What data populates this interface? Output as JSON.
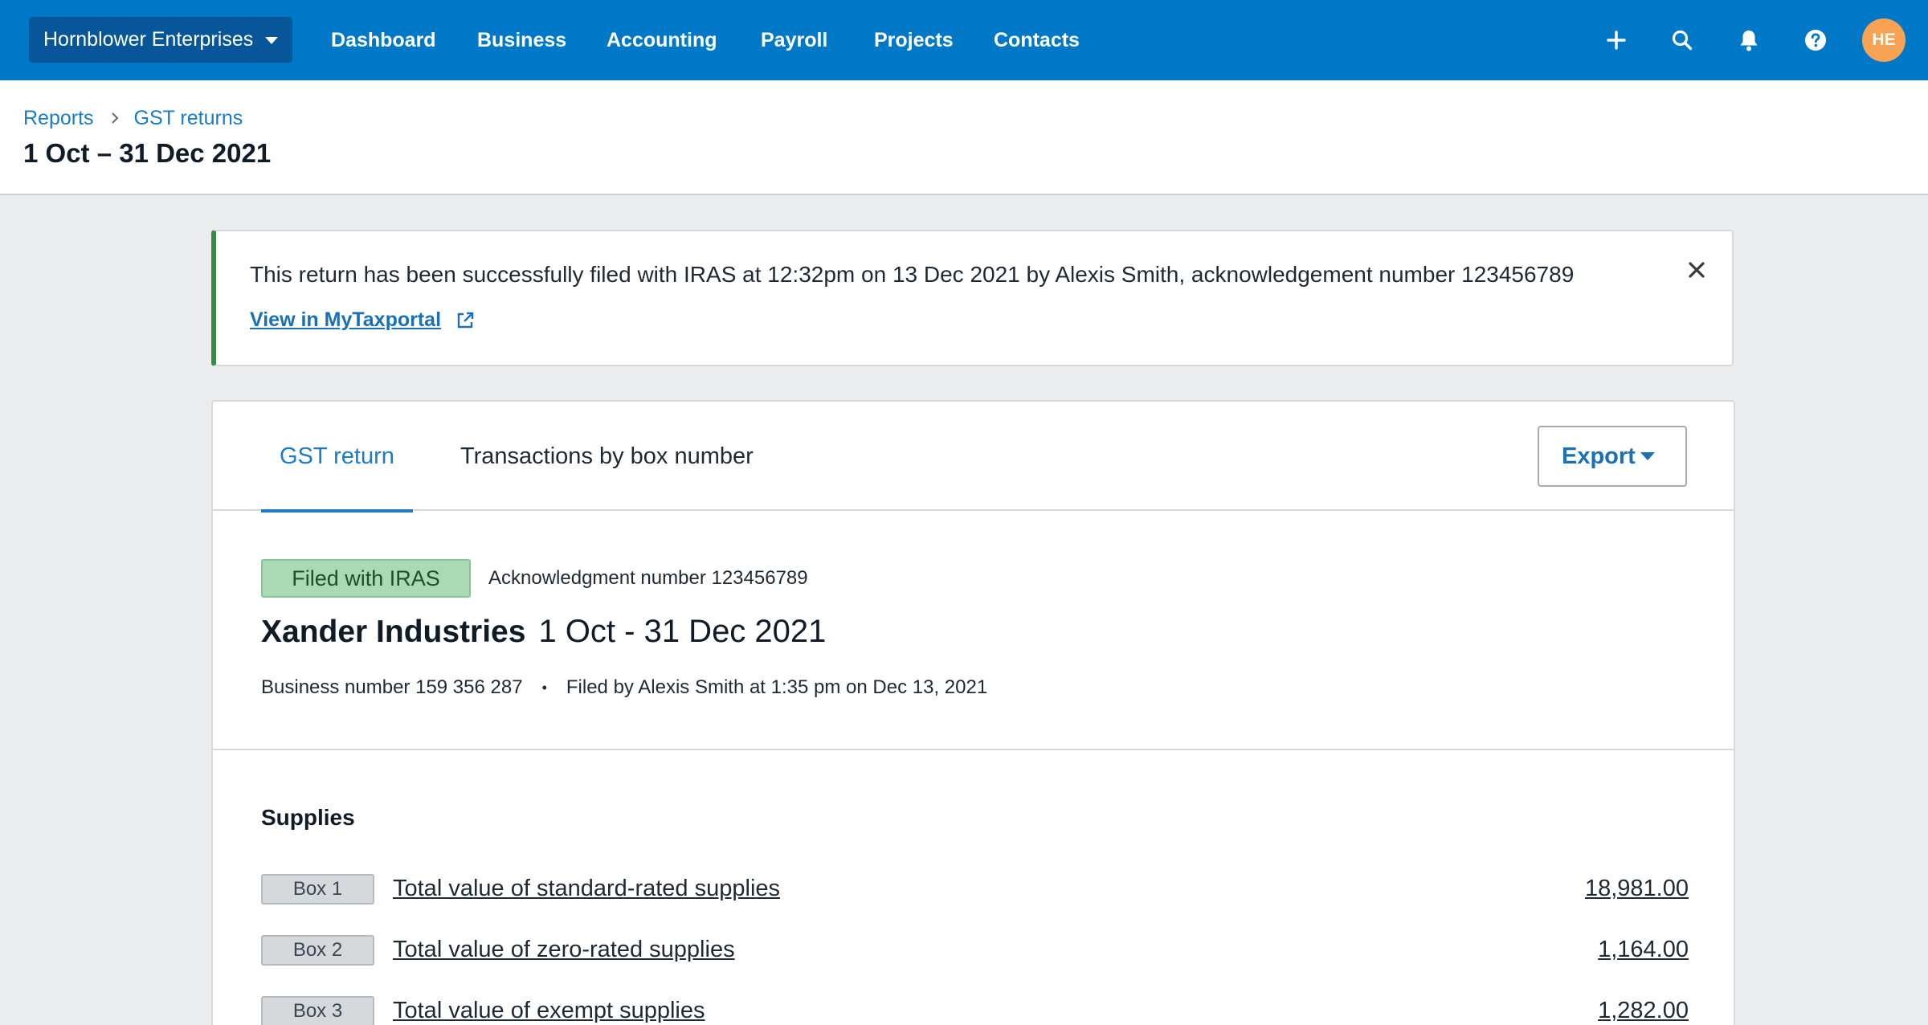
{
  "nav": {
    "org_name": "Hornblower Enterprises",
    "links": [
      "Dashboard",
      "Business",
      "Accounting",
      "Payroll",
      "Projects",
      "Contacts"
    ],
    "icons": [
      "plus-icon",
      "search-icon",
      "bell-icon",
      "help-icon"
    ],
    "avatar_initials": "HE"
  },
  "header": {
    "breadcrumb": [
      "Reports",
      "GST returns"
    ],
    "title": "1 Oct – 31 Dec 2021"
  },
  "banner": {
    "message": "This return has been successfully filed with IRAS at 12:32pm on 13 Dec 2021 by Alexis Smith, acknowledgement number 123456789",
    "link": "View in MyTaxportal"
  },
  "tabs": [
    "GST return",
    "Transactions by box number"
  ],
  "export_label": "Export",
  "report": {
    "status": "Filed with IRAS",
    "ack": "Acknowledgment number 123456789",
    "business_name": "Xander Industries",
    "period": "1 Oct - 31 Dec 2021",
    "business_number": "Business number 159 356 287",
    "dot": "•",
    "filed_by": "Filed by Alexis Smith at 1:35 pm on Dec 13, 2021"
  },
  "supplies": {
    "heading": "Supplies",
    "rows": [
      {
        "box": "Box 1",
        "label": "Total value of standard-rated supplies",
        "value": "18,981.00"
      },
      {
        "box": "Box 2",
        "label": "Total value of zero-rated supplies",
        "value": "1,164.00"
      },
      {
        "box": "Box 3",
        "label": "Total value of exempt supplies",
        "value": "1,282.00"
      }
    ]
  },
  "colors": {
    "nav_bg": "#0078c8",
    "accent": "#1a7cc8",
    "success_border": "#3b8a43",
    "badge_bg": "#a9dab3",
    "avatar_bg": "#f7a353"
  }
}
